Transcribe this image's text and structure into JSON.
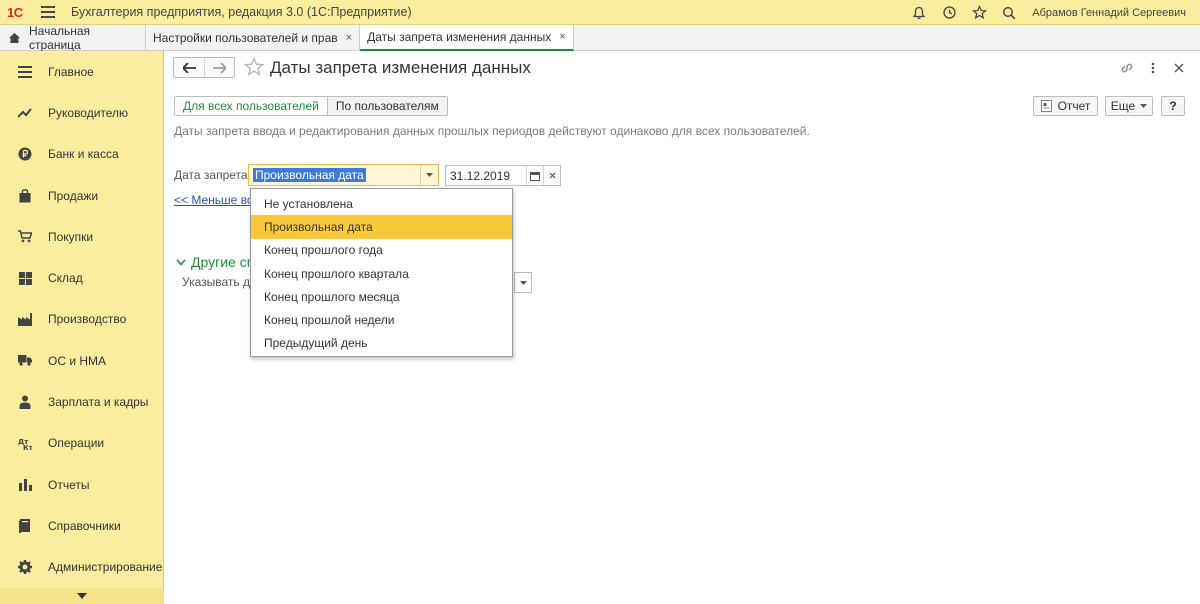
{
  "header": {
    "logo_text": "1С",
    "app_title": "Бухгалтерия предприятия, редакция 3.0  (1С:Предприятие)",
    "user_name": "Абрамов Геннадий Сергеевич",
    "icons": [
      "bell-icon",
      "history-icon",
      "star-icon",
      "search-icon"
    ]
  },
  "tabs": [
    {
      "label": "Начальная страница",
      "closable": false
    },
    {
      "label": "Настройки пользователей и прав",
      "closable": true,
      "close": "×"
    },
    {
      "label": "Даты запрета изменения данных",
      "closable": true,
      "close": "×",
      "active": true
    }
  ],
  "sidebar": {
    "items": [
      {
        "label": "Главное",
        "icon": "menu-icon"
      },
      {
        "label": "Руководителю",
        "icon": "trend-icon"
      },
      {
        "label": "Банк и касса",
        "icon": "ruble-icon"
      },
      {
        "label": "Продажи",
        "icon": "bag-icon"
      },
      {
        "label": "Покупки",
        "icon": "cart-icon"
      },
      {
        "label": "Склад",
        "icon": "warehouse-icon"
      },
      {
        "label": "Производство",
        "icon": "factory-icon"
      },
      {
        "label": "ОС и НМА",
        "icon": "truck-icon"
      },
      {
        "label": "Зарплата и кадры",
        "icon": "person-icon"
      },
      {
        "label": "Операции",
        "icon": "operations-icon"
      },
      {
        "label": "Отчеты",
        "icon": "bar-chart-icon"
      },
      {
        "label": "Справочники",
        "icon": "book-icon"
      },
      {
        "label": "Администрирование",
        "icon": "gear-icon"
      }
    ]
  },
  "form": {
    "title": "Даты запрета изменения данных",
    "segments": {
      "all_users": "Для всех пользователей",
      "by_users": "По пользователям"
    },
    "report_button": "Отчет",
    "more_button": "Еще",
    "help_button": "?",
    "info_text": "Даты запрета ввода и редактирования данных прошлых периодов действуют одинаково для всех пользователей.",
    "date_label": "Дата запрета:",
    "date_kind_value": "Произвольная дата",
    "date_value": "31.12.2019",
    "less_link": "<< Меньше воз",
    "other_section": "Другие сп",
    "specify_label": "Указывать да",
    "dropdown": {
      "options": [
        "Не установлена",
        "Произвольная дата",
        "Конец прошлого года",
        "Конец прошлого квартала",
        "Конец прошлого месяца",
        "Конец прошлой недели",
        "Предыдущий день"
      ],
      "selected_index": 1
    }
  },
  "colors": {
    "panel_yellow": "#fbed9e",
    "accent_green": "#1f8f3a",
    "selection_yellow": "#f9c93b",
    "logo_red": "#d52b1e"
  }
}
